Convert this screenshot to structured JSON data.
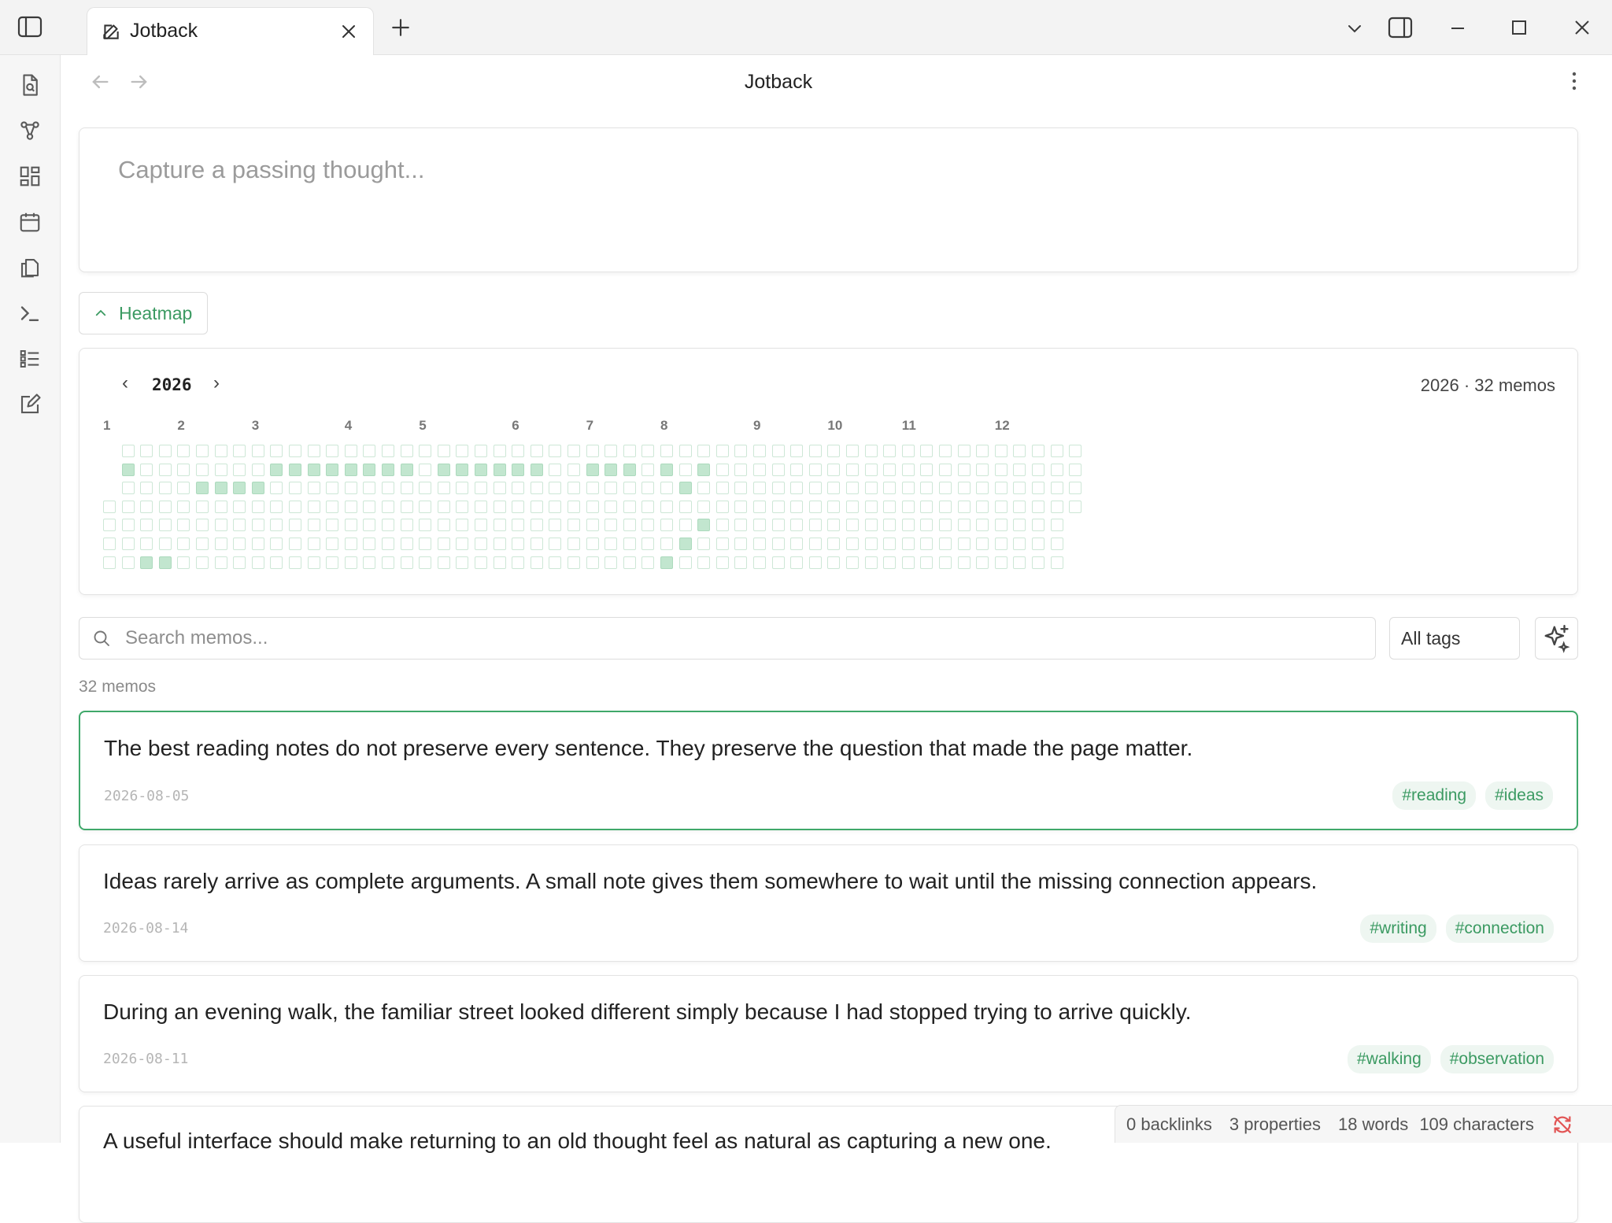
{
  "window": {
    "tab_title": "Jotback"
  },
  "view": {
    "title": "Jotback"
  },
  "composer": {
    "placeholder": "Capture a passing thought..."
  },
  "heatmap": {
    "toggle_label": "Heatmap",
    "year": "2026",
    "summary": "2026 · 32 memos",
    "months": [
      {
        "label": "1",
        "week": 0
      },
      {
        "label": "2",
        "week": 4
      },
      {
        "label": "3",
        "week": 8
      },
      {
        "label": "4",
        "week": 13
      },
      {
        "label": "5",
        "week": 17
      },
      {
        "label": "6",
        "week": 22
      },
      {
        "label": "7",
        "week": 26
      },
      {
        "label": "8",
        "week": 30
      },
      {
        "label": "9",
        "week": 35
      },
      {
        "label": "10",
        "week": 39
      },
      {
        "label": "11",
        "week": 43
      },
      {
        "label": "12",
        "week": 48
      }
    ],
    "first_weekday": 3,
    "total_days": 365,
    "active_cells": [
      [
        1,
        1
      ],
      [
        2,
        5
      ],
      [
        2,
        6
      ],
      [
        2,
        7
      ],
      [
        2,
        8
      ],
      [
        1,
        1
      ],
      [
        1,
        9
      ],
      [
        1,
        10
      ],
      [
        1,
        11
      ],
      [
        1,
        12
      ],
      [
        1,
        13
      ],
      [
        1,
        14
      ],
      [
        1,
        15
      ],
      [
        1,
        16
      ],
      [
        1,
        18
      ],
      [
        1,
        19
      ],
      [
        1,
        20
      ],
      [
        1,
        21
      ],
      [
        1,
        22
      ],
      [
        1,
        23
      ],
      [
        1,
        26
      ],
      [
        1,
        27
      ],
      [
        1,
        28
      ],
      [
        1,
        30
      ],
      [
        1,
        32
      ],
      [
        2,
        31
      ],
      [
        4,
        32
      ],
      [
        5,
        31
      ],
      [
        6,
        2
      ],
      [
        6,
        3
      ],
      [
        6,
        30
      ]
    ]
  },
  "search": {
    "placeholder": "Search memos...",
    "tags_label": "All tags"
  },
  "list": {
    "count_label": "32 memos",
    "memos": [
      {
        "text": "The best reading notes do not preserve every sentence. They preserve the question that made the page matter.",
        "date": "2026-08-05",
        "tags": [
          "#reading",
          "#ideas"
        ]
      },
      {
        "text": "Ideas rarely arrive as complete arguments. A small note gives them somewhere to wait until the missing connection appears.",
        "date": "2026-08-14",
        "tags": [
          "#writing",
          "#connection"
        ]
      },
      {
        "text": "During an evening walk, the familiar street looked different simply because I had stopped trying to arrive quickly.",
        "date": "2026-08-11",
        "tags": [
          "#walking",
          "#observation"
        ]
      },
      {
        "text": "A useful interface should make returning to an old thought feel as natural as capturing a new one.",
        "date": "",
        "tags": []
      }
    ]
  },
  "status": {
    "backlinks": "0 backlinks",
    "properties": "3 properties",
    "words": "18 words",
    "characters": "109 characters"
  },
  "colors": {
    "accent": "#3fa86a",
    "heat_on": "#c2e6cf",
    "heat_off_border": "#cde7d6",
    "sync_error": "#e25555"
  }
}
